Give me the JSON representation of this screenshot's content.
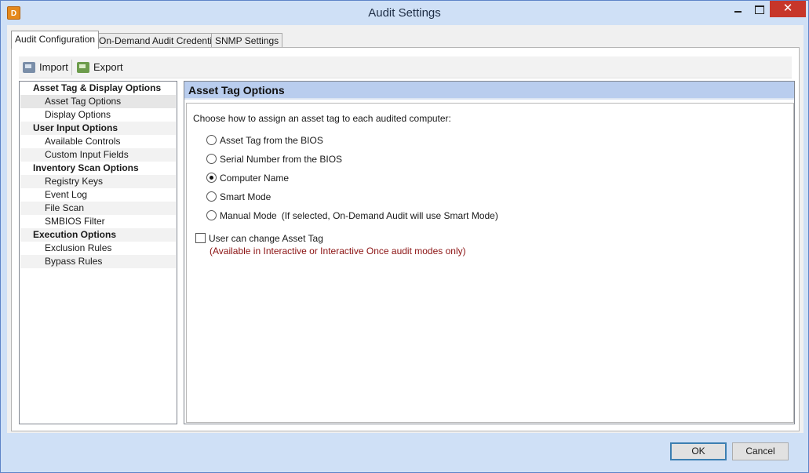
{
  "window": {
    "title": "Audit Settings",
    "app_icon_glyph": "D",
    "controls": {
      "minimize": "minimize-icon",
      "maximize": "maximize-icon",
      "close": "close-icon",
      "close_glyph": "✕"
    }
  },
  "tabs": [
    {
      "label": "Audit Configuration",
      "active": true
    },
    {
      "label": "On-Demand Audit Credentials",
      "active": false
    },
    {
      "label": "SNMP Settings",
      "active": false
    }
  ],
  "toolbar": {
    "import_label": "Import",
    "export_label": "Export",
    "import_icon": "import-icon",
    "export_icon": "export-icon"
  },
  "nav": {
    "items": [
      {
        "label": "Asset Tag & Display Options",
        "type": "group"
      },
      {
        "label": "Asset Tag Options",
        "type": "sub",
        "selected": true
      },
      {
        "label": "Display Options",
        "type": "sub"
      },
      {
        "label": "User Input Options",
        "type": "group"
      },
      {
        "label": "Available Controls",
        "type": "sub"
      },
      {
        "label": "Custom Input Fields",
        "type": "sub"
      },
      {
        "label": "Inventory Scan Options",
        "type": "group"
      },
      {
        "label": "Registry Keys",
        "type": "sub"
      },
      {
        "label": "Event Log",
        "type": "sub"
      },
      {
        "label": "File Scan",
        "type": "sub"
      },
      {
        "label": "SMBIOS Filter",
        "type": "sub"
      },
      {
        "label": "Execution Options",
        "type": "group"
      },
      {
        "label": "Exclusion Rules",
        "type": "sub"
      },
      {
        "label": "Bypass Rules",
        "type": "sub"
      }
    ]
  },
  "content": {
    "header": "Asset Tag Options",
    "instruction": "Choose how to assign an asset tag to each audited computer:",
    "options": [
      {
        "label": "Asset Tag from the BIOS",
        "checked": false
      },
      {
        "label": "Serial Number from the BIOS",
        "checked": false
      },
      {
        "label": "Computer Name",
        "checked": true
      },
      {
        "label": "Smart Mode",
        "checked": false
      },
      {
        "label": "Manual Mode",
        "checked": false,
        "note": "(If selected, On-Demand Audit will use Smart Mode)"
      }
    ],
    "checkbox": {
      "label": "User can change Asset Tag",
      "checked": false,
      "note": "(Available in Interactive or Interactive Once audit modes only)"
    }
  },
  "buttons": {
    "ok": "OK",
    "cancel": "Cancel"
  },
  "colors": {
    "accent": "#b9cdee",
    "note_red": "#8b1212",
    "close_red": "#c7362a"
  }
}
